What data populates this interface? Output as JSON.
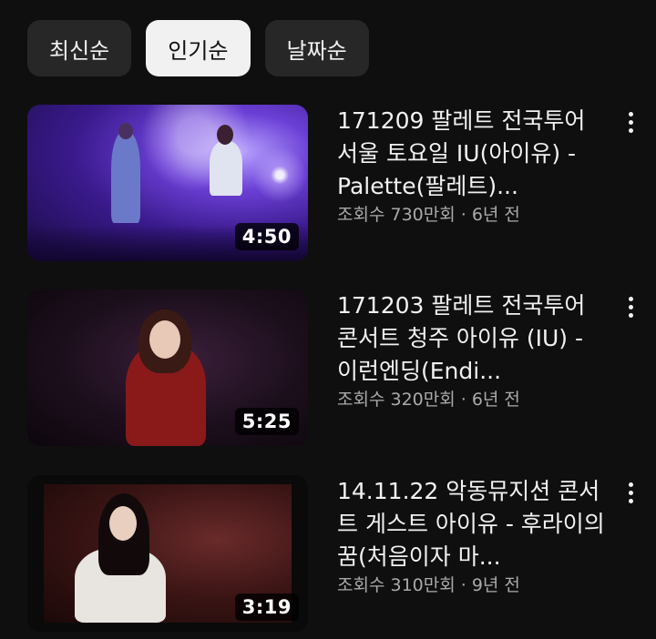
{
  "chips": [
    {
      "label": "최신순",
      "selected": false
    },
    {
      "label": "인기순",
      "selected": true
    },
    {
      "label": "날짜순",
      "selected": false
    }
  ],
  "videos": [
    {
      "title": "171209 팔레트 전국투어 서울 토요일 IU(아이유) - Palette(팔레트)...",
      "meta": "조회수 730만회 · 6년 전",
      "duration": "4:50"
    },
    {
      "title": "171203 팔레트 전국투어 콘서트 청주 아이유 (IU) - 이런엔딩(Endi...",
      "meta": "조회수 320만회 · 6년 전",
      "duration": "5:25"
    },
    {
      "title": "14.11.22 악동뮤지션 콘서트 게스트 아이유 - 후라이의 꿈(처음이자 마...",
      "meta": "조회수 310만회 · 9년 전",
      "duration": "3:19"
    }
  ]
}
